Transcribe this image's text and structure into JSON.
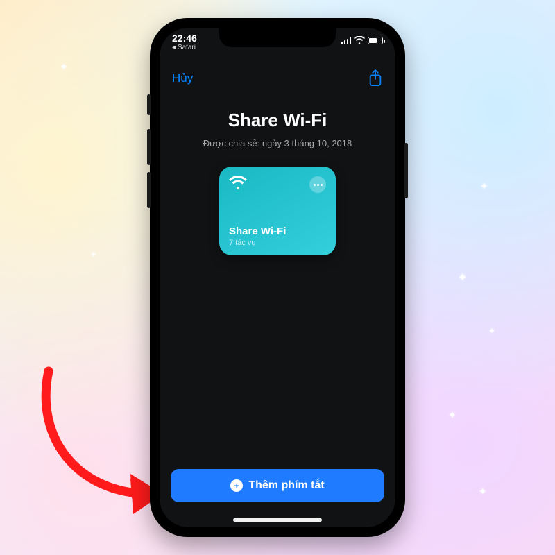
{
  "status": {
    "time": "22:46",
    "back_app_label": "Safari"
  },
  "nav": {
    "cancel_label": "Hủy"
  },
  "page": {
    "title": "Share Wi-Fi",
    "subtitle": "Được chia sẻ: ngày 3 tháng 10, 2018"
  },
  "shortcut_card": {
    "name": "Share Wi-Fi",
    "meta": "7 tác vụ"
  },
  "cta": {
    "label": "Thêm phím tắt"
  },
  "colors": {
    "accent": "#0a84ff",
    "cta_bg": "#1f7bff",
    "card_bg": "#22c1cf",
    "screen_bg": "#111214"
  }
}
